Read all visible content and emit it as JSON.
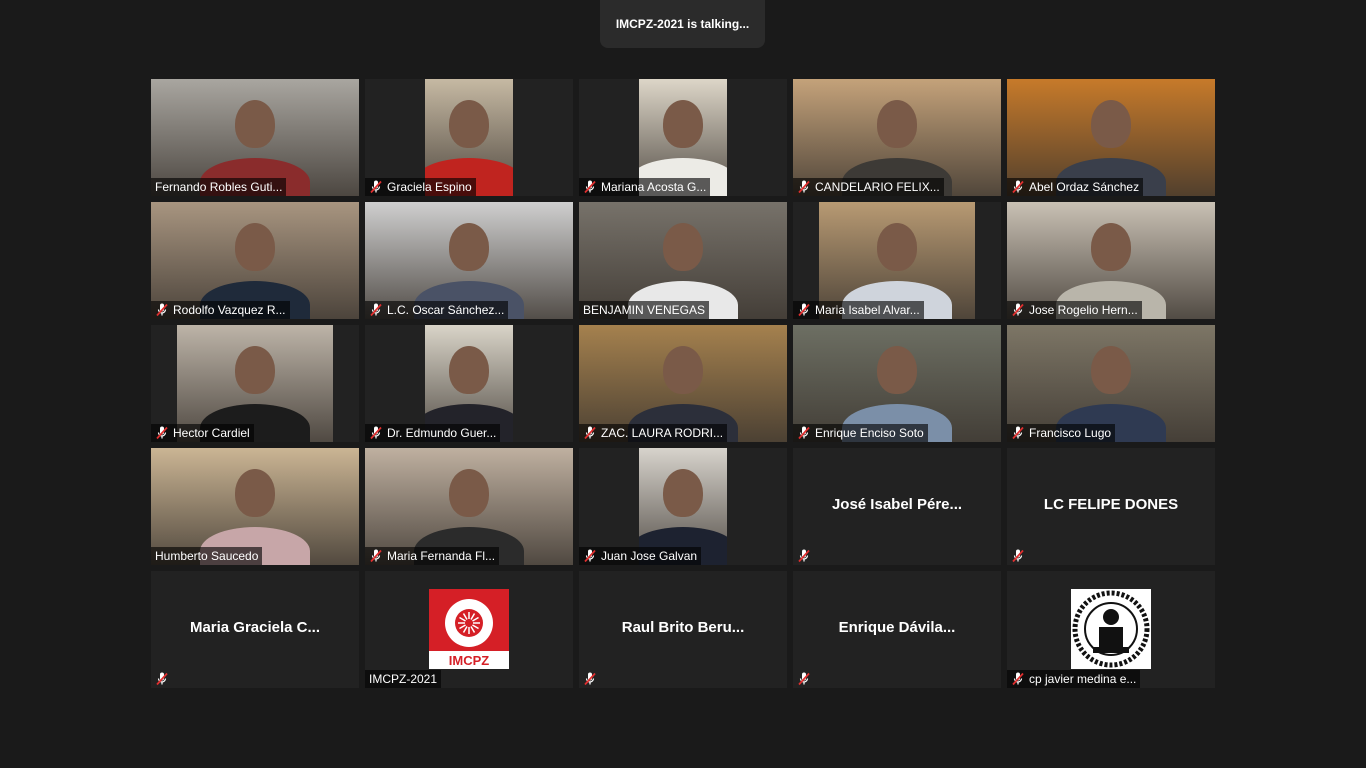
{
  "banner": {
    "text": "IMCPZ-2021 is talking..."
  },
  "participants": [
    {
      "name": "Fernando Robles Guti...",
      "muted": false,
      "video": true,
      "bg": "#a9a6a0",
      "body": "#8a2c2c",
      "style": "full"
    },
    {
      "name": "Graciela Espino",
      "muted": true,
      "video": true,
      "bg": "#c6b9a3",
      "body": "#c0241f",
      "style": "narrow"
    },
    {
      "name": "Mariana Acosta G...",
      "muted": true,
      "video": true,
      "bg": "#ddd6c8",
      "body": "#ecebe6",
      "style": "narrow"
    },
    {
      "name": "CANDELARIO FELIX...",
      "muted": true,
      "video": true,
      "bg": "#c4a27a",
      "body": "#3d3a36",
      "style": "full"
    },
    {
      "name": "Abel Ordaz Sánchez",
      "muted": true,
      "video": true,
      "bg": "#c77a2a",
      "body": "#3a3f4b",
      "style": "full"
    },
    {
      "name": "Rodolfo Vazquez R...",
      "muted": true,
      "video": true,
      "bg": "#a89580",
      "body": "#1f2a3a",
      "style": "full"
    },
    {
      "name": "L.C. Oscar Sánchez...",
      "muted": true,
      "video": true,
      "bg": "#cfcfcf",
      "body": "#4a5266",
      "style": "full"
    },
    {
      "name": "BENJAMIN VENEGAS",
      "muted": false,
      "video": true,
      "bg": "#77726a",
      "body": "#e8e8e8",
      "style": "full"
    },
    {
      "name": "Maria Isabel Alvar...",
      "muted": true,
      "video": true,
      "bg": "#b89a73",
      "body": "#cfd4dc",
      "style": "mid"
    },
    {
      "name": "Jose Rogelio Hern...",
      "muted": true,
      "video": true,
      "bg": "#c9c1b4",
      "body": "#b9b5aa",
      "style": "full"
    },
    {
      "name": "Hector Cardiel",
      "muted": true,
      "video": true,
      "bg": "#bdb4a8",
      "body": "#1c1c1c",
      "style": "mid"
    },
    {
      "name": "Dr. Edmundo Guer...",
      "muted": true,
      "video": true,
      "bg": "#d9d4c8",
      "body": "#23232a",
      "style": "narrow"
    },
    {
      "name": "ZAC. LAURA RODRI...",
      "muted": true,
      "video": true,
      "bg": "#a5814e",
      "body": "#2c2f3a",
      "style": "full"
    },
    {
      "name": "Enrique Enciso Soto",
      "muted": true,
      "video": true,
      "bg": "#6d6f63",
      "body": "#7b8fa8",
      "style": "full"
    },
    {
      "name": "Francisco Lugo",
      "muted": true,
      "video": true,
      "bg": "#7d7666",
      "body": "#2f3a52",
      "style": "full"
    },
    {
      "name": "Humberto Saucedo",
      "muted": false,
      "video": true,
      "bg": "#cbb594",
      "body": "#c7a6a8",
      "style": "full"
    },
    {
      "name": "Maria Fernanda Fl...",
      "muted": true,
      "video": true,
      "bg": "#bfb0a0",
      "body": "#2b2b2b",
      "style": "full"
    },
    {
      "name": "Juan Jose Galvan",
      "muted": true,
      "video": true,
      "bg": "#d7d3cc",
      "body": "#1d2230",
      "style": "narrow"
    },
    {
      "name": "",
      "muted": true,
      "video": false,
      "center": "José Isabel Pére..."
    },
    {
      "name": "",
      "muted": true,
      "video": false,
      "center": "LC FELIPE DONES"
    },
    {
      "name": "",
      "muted": true,
      "video": false,
      "center": "Maria  Graciela  C..."
    },
    {
      "name": "IMCPZ-2021",
      "muted": false,
      "video": false,
      "avatar": "imcpz-logo",
      "logo_text": "IMCPZ"
    },
    {
      "name": "",
      "muted": true,
      "video": false,
      "center": "Raul Brito Beru..."
    },
    {
      "name": "",
      "muted": true,
      "video": false,
      "center": "Enrique  Dávila..."
    },
    {
      "name": "cp javier medina e...",
      "muted": true,
      "video": false,
      "avatar": "seal-logo"
    }
  ],
  "colors": {
    "muted_icon": "#e02f2f",
    "tile_bg": "#222222",
    "page_bg": "#1a1a1a",
    "logo_red": "#d51f26"
  }
}
